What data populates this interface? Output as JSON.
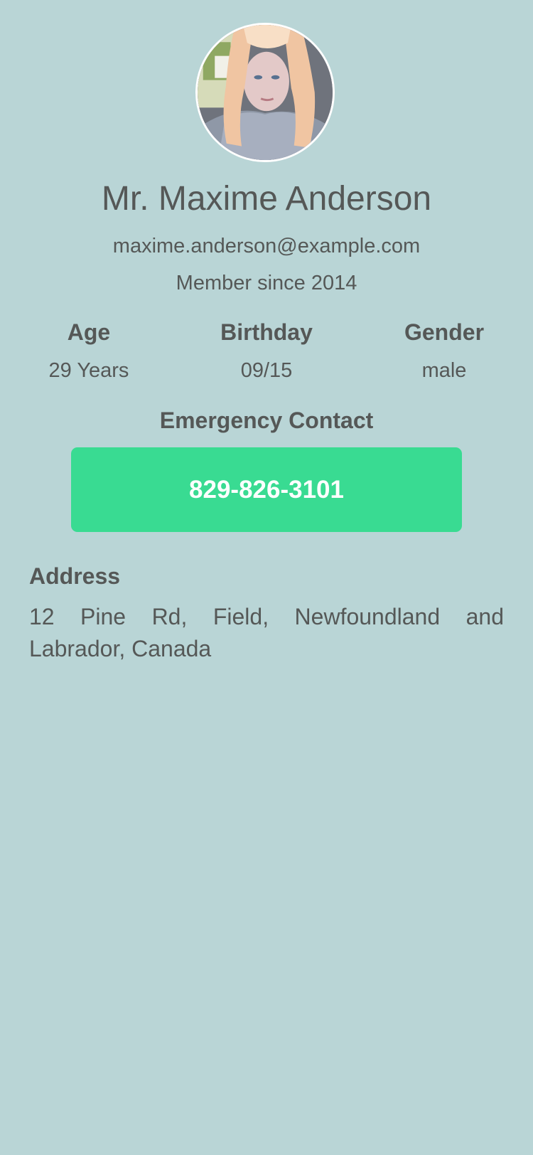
{
  "profile": {
    "avatar_icon": "profile-photo",
    "name": "Mr. Maxime Anderson",
    "email": "maxime.anderson@example.com",
    "member_since": "Member since 2014"
  },
  "stats": {
    "age": {
      "label": "Age",
      "value": "29 Years"
    },
    "birthday": {
      "label": "Birthday",
      "value": "09/15"
    },
    "gender": {
      "label": "Gender",
      "value": "male"
    }
  },
  "emergency": {
    "title": "Emergency Contact",
    "phone": "829-826-3101",
    "button_color": "#39db92"
  },
  "address": {
    "title": "Address",
    "text": "12 Pine Rd, Field, Newfoundland and Labrador, Canada"
  },
  "colors": {
    "background": "#b9d5d6",
    "text": "#555857",
    "button_text": "#ffffff"
  }
}
